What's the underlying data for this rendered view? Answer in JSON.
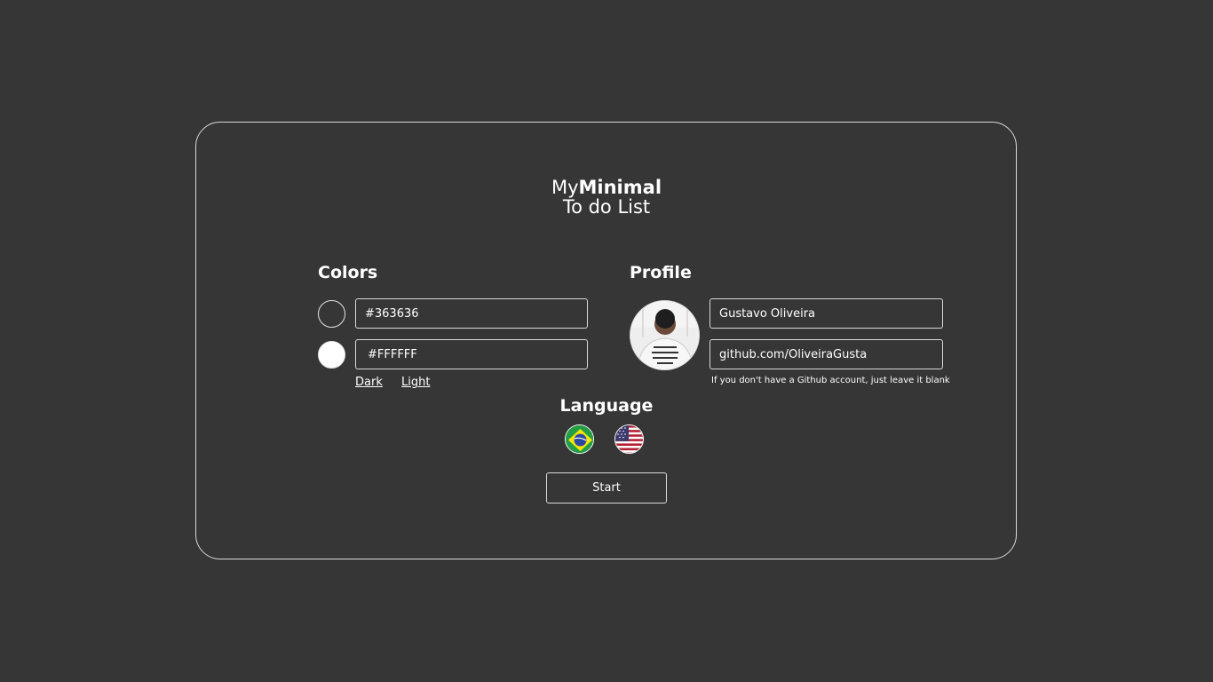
{
  "app": {
    "title_prefix": "My",
    "title_bold": "Minimal",
    "title_line2": "To do List"
  },
  "colors": {
    "heading": "Colors",
    "primary_value": "#363636",
    "secondary_value": "#FFFFFF",
    "primary_swatch": "#363636",
    "secondary_swatch": "#FFFFFF",
    "dark_label": "Dark",
    "light_label": "Light"
  },
  "profile": {
    "heading": "Profile",
    "name_value": "Gustavo Oliveira",
    "github_value": "github.com/OliveiraGusta",
    "hint": "If you don't have a Github account, just leave it blank"
  },
  "language": {
    "heading": "Language",
    "options": [
      "brazil-flag-icon",
      "usa-flag-icon"
    ]
  },
  "actions": {
    "start_label": "Start"
  },
  "theme": {
    "background": "#363636",
    "foreground": "#FFFFFF",
    "border": "#D9D9D9"
  }
}
